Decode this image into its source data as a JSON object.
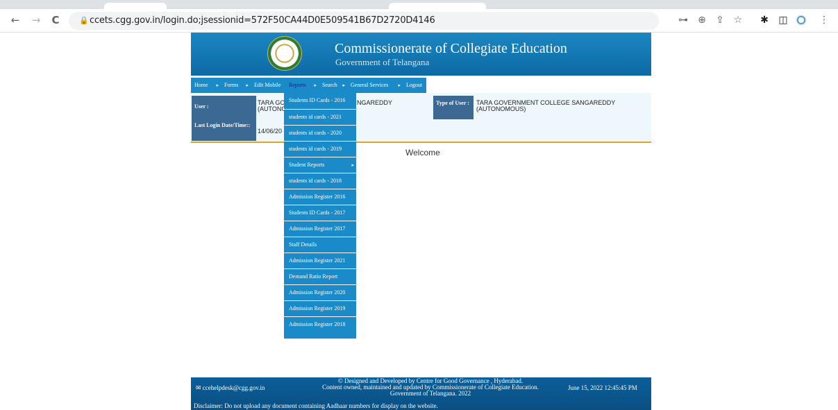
{
  "browser": {
    "url": "ccets.cgg.gov.in/login.do;jsessionid=572F50CA44D0E509541B67D2720D4146",
    "nav_icons": [
      "back-arrow-icon",
      "forward-arrow-icon",
      "reload-icon"
    ],
    "glyphs": {
      "back": "←",
      "forward": "→",
      "reload": "C",
      "lock": "🔒",
      "key": "⊶",
      "zoom": "⊕",
      "share": "⇪",
      "star": "☆",
      "puzzle": "✱",
      "sidebar": "◫",
      "menu": "⋮"
    }
  },
  "header": {
    "title": "Commissionerate of Collegiate Education",
    "subtitle": "Government of Telangana"
  },
  "menu": {
    "items": [
      {
        "label": "Home",
        "arrow": "▸"
      },
      {
        "label": "Forms",
        "arrow": "▸"
      },
      {
        "label": "Edit Mobile",
        "arrow": ""
      },
      {
        "label": "Reports",
        "arrow": "▸"
      },
      {
        "label": "Search",
        "arrow": "▸"
      },
      {
        "label": "General Services",
        "arrow": "▸"
      },
      {
        "label": "Logout",
        "arrow": ""
      }
    ]
  },
  "reports_dropdown": [
    {
      "label": "Students ID Cards - 2016",
      "arrow": ""
    },
    {
      "label": "students id cards - 2021",
      "arrow": ""
    },
    {
      "label": "students id cards - 2020",
      "arrow": ""
    },
    {
      "label": "students id cards - 2019",
      "arrow": ""
    },
    {
      "label": "Student Reports",
      "arrow": "▸"
    },
    {
      "label": "students id cards - 2018",
      "arrow": ""
    },
    {
      "label": "Admission Register 2016",
      "arrow": ""
    },
    {
      "label": "Students ID Cards - 2017",
      "arrow": ""
    },
    {
      "label": "Admission Register 2017",
      "arrow": ""
    },
    {
      "label": "Staff Details",
      "arrow": ""
    },
    {
      "label": "Admission Register 2021",
      "arrow": ""
    },
    {
      "label": "Demand Ratio Report",
      "arrow": ""
    },
    {
      "label": "Admission Register 2020",
      "arrow": ""
    },
    {
      "label": "Admission Register 2019",
      "arrow": ""
    },
    {
      "label": "Admission Register 2018",
      "arrow": ""
    }
  ],
  "info": {
    "user_label": "User :",
    "user_value_line1": "TARA GO",
    "user_value_tail": "NGAREDDY",
    "user_value_line2": "(AUTONO",
    "last_login_label": "Last Login Date/Time::",
    "last_login_value": "14/06/20",
    "type_label": "Type of User :",
    "type_value_line1": "TARA GOVERNMENT COLLEGE SANGAREDDY",
    "type_value_line2": "(AUTONOMOUS)"
  },
  "main": {
    "welcome": "Welcome"
  },
  "footer": {
    "email": "✉ ccehelpdesk@cgg.gov.in",
    "line1": "© Designed and Developed by Centre for Good Governance , Hyderabad.",
    "line2": "Content owned, maintained and updated by Commissionerate of Collegiate Education.",
    "line3": "Government of Telangana. 2022",
    "datetime": "June 15, 2022 12:45:45 PM",
    "disclaimer": "Disclaimer:  Do not upload any document containing Aadhaar numbers for display on the website."
  },
  "colors": {
    "menu_blue": "#1b8ac8",
    "header_blue": "#0d6aa5",
    "label_blue": "#3c6894",
    "accent_orange": "#e0a526",
    "footer_blue": "#0a4f82"
  }
}
